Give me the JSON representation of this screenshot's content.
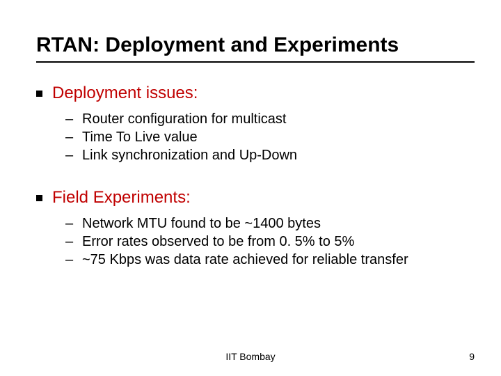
{
  "title": "RTAN: Deployment and Experiments",
  "sections": [
    {
      "heading": "Deployment issues:",
      "items": [
        "Router configuration for multicast",
        "Time To Live value",
        "Link synchronization and Up-Down"
      ]
    },
    {
      "heading": "Field Experiments:",
      "items": [
        "Network MTU found to be ~1400 bytes",
        "Error rates observed to be from 0. 5% to 5%",
        "~75 Kbps was data rate achieved for reliable transfer"
      ]
    }
  ],
  "footer": "IIT Bombay",
  "page_number": "9"
}
